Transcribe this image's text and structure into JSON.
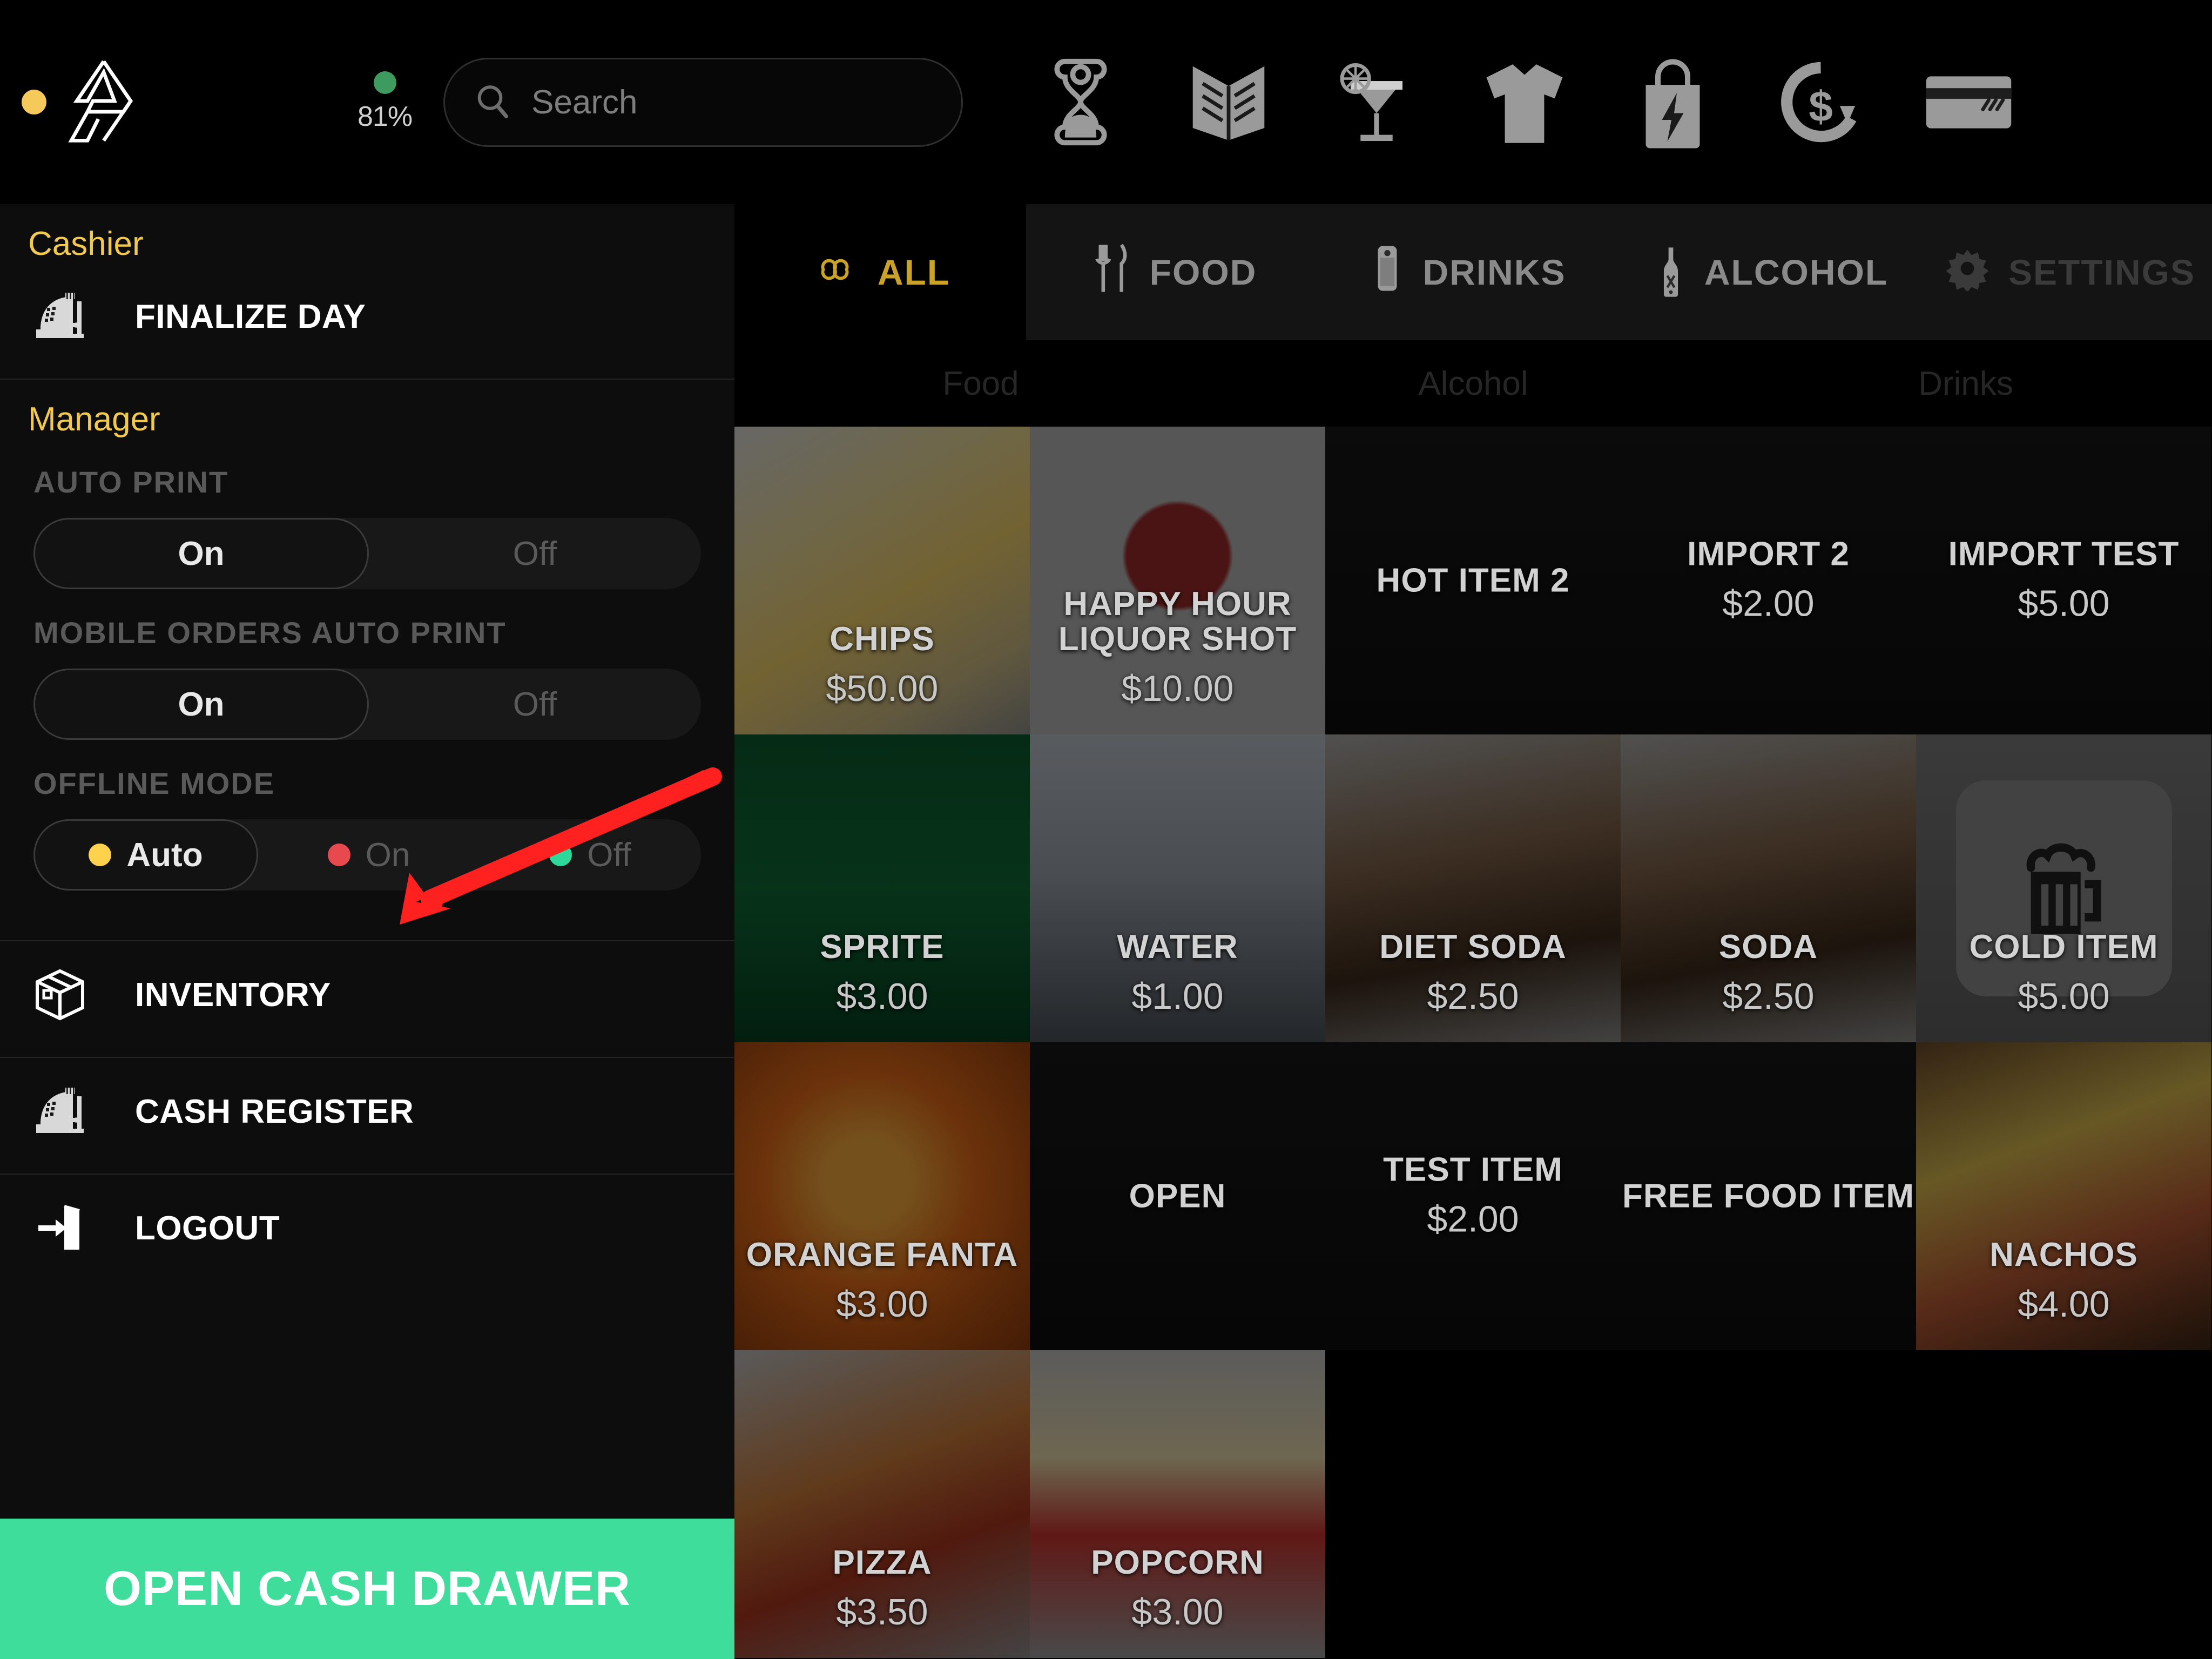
{
  "topbar": {
    "status_dot_color": "#F5CA5B",
    "logo_icon": "logo-a-icon",
    "battery_percent": "81%",
    "battery_dot_color": "#3E9B5F",
    "search": {
      "placeholder": "Search",
      "value": "",
      "icon": "search-icon"
    },
    "icons": [
      {
        "name": "hourglass-icon",
        "label": "Hourglass"
      },
      {
        "name": "open-book-icon",
        "label": "Open Book"
      },
      {
        "name": "cocktail-icon",
        "label": "Cocktail"
      },
      {
        "name": "tshirt-icon",
        "label": "T-Shirt"
      },
      {
        "name": "shopping-bag-bolt-icon",
        "label": "Quick Sale"
      },
      {
        "name": "refund-icon",
        "label": "Refund"
      },
      {
        "name": "credit-card-icon",
        "label": "Credit Card"
      }
    ]
  },
  "sidebar": {
    "cashier_heading": "Cashier",
    "finalize_day": {
      "label": "FINALIZE DAY",
      "icon": "cash-register-icon"
    },
    "manager_heading": "Manager",
    "auto_print": {
      "label": "AUTO PRINT",
      "options": [
        "On",
        "Off"
      ],
      "selected": "On"
    },
    "mobile_orders_auto_print": {
      "label": "MOBILE ORDERS AUTO PRINT",
      "options": [
        "On",
        "Off"
      ],
      "selected": "On"
    },
    "offline_mode": {
      "label": "OFFLINE MODE",
      "options": [
        {
          "label": "Auto",
          "dot": "#FFD24D"
        },
        {
          "label": "On",
          "dot": "#E8494F"
        },
        {
          "label": "Off",
          "dot": "#2ED89B"
        }
      ],
      "selected": "Auto"
    },
    "items": [
      {
        "label": "INVENTORY",
        "icon": "box-icon"
      },
      {
        "label": "CASH REGISTER",
        "icon": "cash-register-icon"
      },
      {
        "label": "LOGOUT",
        "icon": "logout-icon"
      }
    ],
    "open_cash_drawer": {
      "label": "OPEN CASH DRAWER",
      "color": "#3FDD9B"
    }
  },
  "main": {
    "tabs": [
      {
        "label": "ALL",
        "icon": "infinity-icon",
        "active": true
      },
      {
        "label": "FOOD",
        "icon": "cutlery-icon",
        "active": false
      },
      {
        "label": "DRINKS",
        "icon": "soda-can-icon",
        "active": false
      },
      {
        "label": "ALCOHOL",
        "icon": "bottle-icon",
        "active": false
      },
      {
        "label": "SETTINGS",
        "icon": "gear-icon",
        "active": false,
        "dim": true
      }
    ],
    "subcategories": [
      "Food",
      "Alcohol",
      "Drinks"
    ],
    "products": [
      {
        "name": "CHIPS",
        "price": "$50.00",
        "art": "chips",
        "row": 0,
        "col": 0
      },
      {
        "name": "HAPPY HOUR\nLIQUOR SHOT",
        "price": "$10.00",
        "art": "happyhour",
        "row": 0,
        "col": 1
      },
      {
        "name": "HOT ITEM 2",
        "price": "",
        "art": "none",
        "row": 0,
        "col": 2
      },
      {
        "name": "IMPORT 2",
        "price": "$2.00",
        "art": "none",
        "row": 0,
        "col": 3
      },
      {
        "name": "IMPORT TEST",
        "price": "$5.00",
        "art": "none",
        "row": 0,
        "col": 4
      },
      {
        "name": "SPRITE",
        "price": "$3.00",
        "art": "sprite",
        "row": 1,
        "col": 0
      },
      {
        "name": "WATER",
        "price": "$1.00",
        "art": "water",
        "row": 1,
        "col": 1
      },
      {
        "name": "DIET SODA",
        "price": "$2.50",
        "art": "cola",
        "row": 1,
        "col": 2
      },
      {
        "name": "SODA",
        "price": "$2.50",
        "art": "cola",
        "row": 1,
        "col": 3
      },
      {
        "name": "COLD ITEM",
        "price": "$5.00",
        "art": "beermug",
        "row": 1,
        "col": 4
      },
      {
        "name": "ORANGE FANTA",
        "price": "$3.00",
        "art": "fanta",
        "row": 2,
        "col": 0
      },
      {
        "name": "OPEN",
        "price": "",
        "art": "none",
        "row": 2,
        "col": 1
      },
      {
        "name": "TEST ITEM",
        "price": "$2.00",
        "art": "none",
        "row": 2,
        "col": 2
      },
      {
        "name": "FREE FOOD ITEM",
        "price": "",
        "art": "none",
        "row": 2,
        "col": 3
      },
      {
        "name": "NACHOS",
        "price": "$4.00",
        "art": "nachos",
        "row": 2,
        "col": 4
      },
      {
        "name": "PIZZA",
        "price": "$3.50",
        "art": "pizza",
        "row": 3,
        "col": 0
      },
      {
        "name": "POPCORN",
        "price": "$3.00",
        "art": "popcorn",
        "row": 3,
        "col": 1
      }
    ]
  },
  "annotation": {
    "arrow_color": "#FF2020",
    "points_at": "OFFLINE MODE"
  }
}
